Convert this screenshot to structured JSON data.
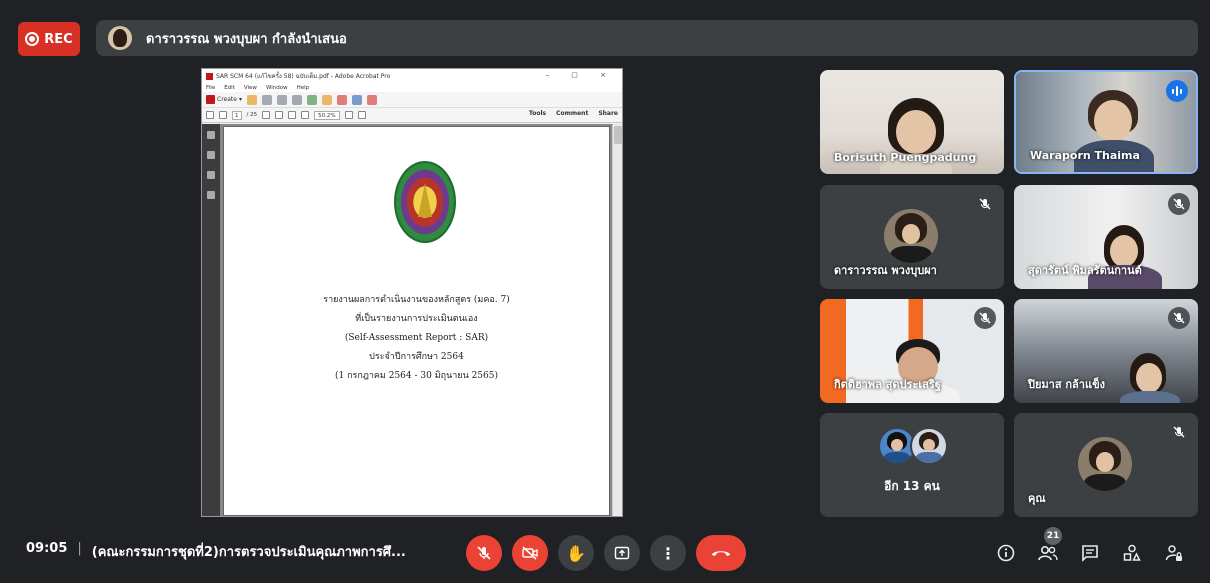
{
  "recording": {
    "label": "REC"
  },
  "presenter_bar": {
    "text": "ดาราวรรณ พวงบุบผา กำลังนำเสนอ"
  },
  "shared_window": {
    "title": "SAR SCM 64 (แก้ไขครั้ง 58) ฉบับเต็ม.pdf - Adobe Acrobat Pro",
    "menu": [
      "File",
      "Edit",
      "View",
      "Window",
      "Help"
    ],
    "create_label": "Create",
    "page_field": "1",
    "page_total": "/ 25",
    "zoom": "50.2%",
    "pane_tabs": [
      "Tools",
      "Comment",
      "Share"
    ],
    "document_lines": [
      "รายงานผลการดำเนินงานของหลักสูตร (มคอ. 7)",
      "ที่เป็นรายงานการประเมินตนเอง",
      "(Self-Assessment Report : SAR)",
      "ประจำปีการศึกษา 2564",
      "(1 กรกฎาคม 2564 - 30 มิถุนายน 2565)"
    ]
  },
  "participants": [
    {
      "name": "Borisuth Puengpadung",
      "muted": false,
      "speaking": false
    },
    {
      "name": "Waraporn Thaima",
      "muted": false,
      "speaking": true
    },
    {
      "name": "ดาราวรรณ พวงบุบผา",
      "muted": true
    },
    {
      "name": "สุดารัตน์ พิมลรัตนกานต์",
      "muted": true
    },
    {
      "name": "กิตติฮาพล สุดประเสริฐ",
      "muted": true
    },
    {
      "name": "ปิยมาส กล้าแข็ง",
      "muted": true
    },
    {
      "name": "อีก 13 คน",
      "muted": false
    },
    {
      "name": "คุณ",
      "muted": true
    }
  ],
  "bottom_bar": {
    "time": "09:05",
    "separator": "|",
    "meeting_title": "(คณะกรรมการชุดที่2)การตรวจประเมินคุณภาพการศึ...",
    "participant_count": "21"
  },
  "colors": {
    "accent_red": "#ea4335",
    "bg": "#202124",
    "tile": "#3c4043",
    "speaking_blue": "#1a73e8"
  }
}
